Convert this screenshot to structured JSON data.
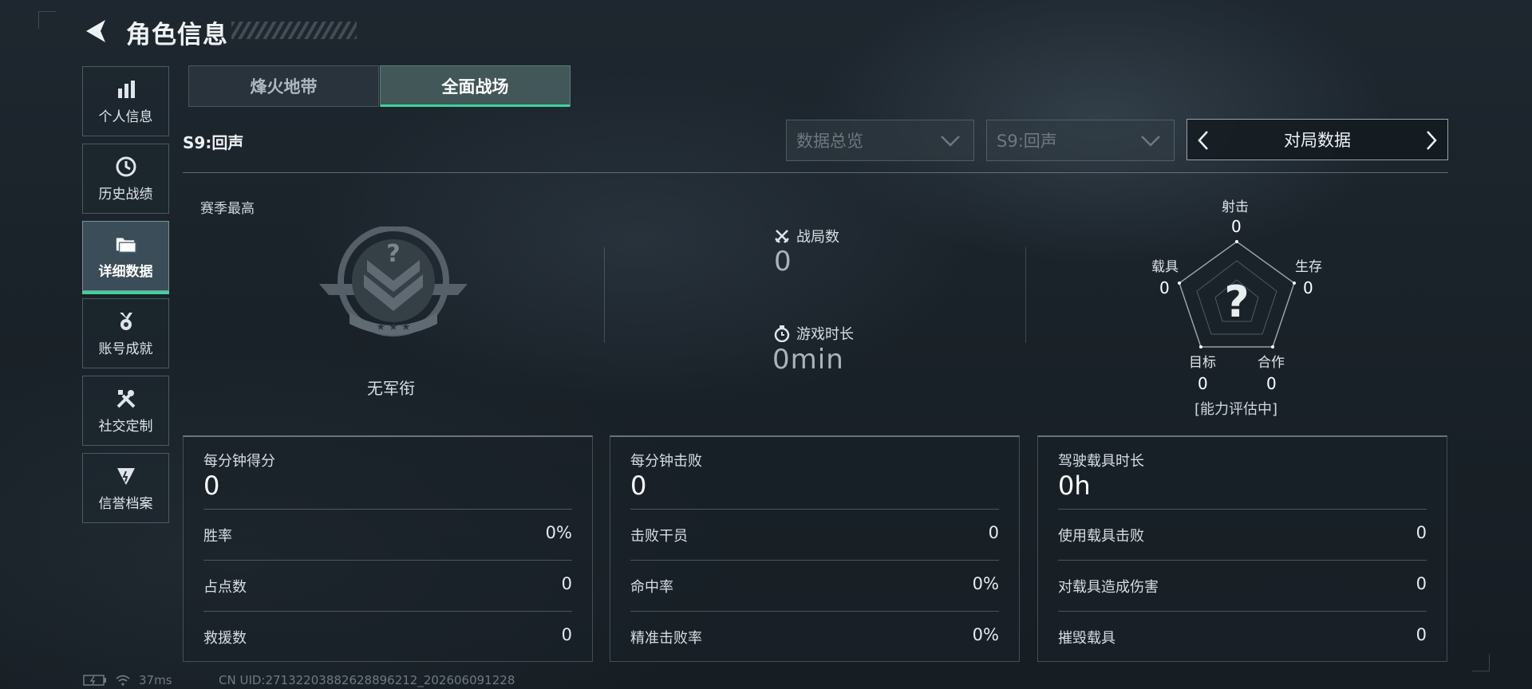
{
  "header": {
    "title": "角色信息"
  },
  "sidebar": {
    "items": [
      {
        "label": "个人信息",
        "icon": "bar-chart-icon"
      },
      {
        "label": "历史战绩",
        "icon": "history-clock-icon"
      },
      {
        "label": "详细数据",
        "icon": "folder-icon",
        "active": true
      },
      {
        "label": "账号成就",
        "icon": "medal-icon"
      },
      {
        "label": "社交定制",
        "icon": "tools-icon"
      },
      {
        "label": "信誉档案",
        "icon": "shield-badge-icon"
      }
    ]
  },
  "tabs": [
    {
      "label": "烽火地带",
      "selected": false
    },
    {
      "label": "全面战场",
      "selected": true
    }
  ],
  "season_label": "S9:回声",
  "filters": {
    "overview": "数据总览",
    "season": "S9:回声",
    "switcher": "对局数据"
  },
  "season_best": {
    "label": "赛季最高",
    "rank": "无军衔"
  },
  "stats": {
    "games_label": "战局数",
    "games_value": "0",
    "time_label": "游戏时长",
    "time_value": "0min"
  },
  "radar": {
    "axes": [
      {
        "label": "射击",
        "value": "0"
      },
      {
        "label": "生存",
        "value": "0"
      },
      {
        "label": "合作",
        "value": "0"
      },
      {
        "label": "目标",
        "value": "0"
      },
      {
        "label": "载具",
        "value": "0"
      }
    ],
    "status": "[能力评估中]"
  },
  "cards": [
    {
      "title": "每分钟得分",
      "value": "0",
      "rows": [
        {
          "label": "胜率",
          "value": "0%"
        },
        {
          "label": "占点数",
          "value": "0"
        },
        {
          "label": "救援数",
          "value": "0"
        }
      ]
    },
    {
      "title": "每分钟击败",
      "value": "0",
      "rows": [
        {
          "label": "击败干员",
          "value": "0"
        },
        {
          "label": "命中率",
          "value": "0%"
        },
        {
          "label": "精准击败率",
          "value": "0%"
        }
      ]
    },
    {
      "title": "驾驶载具时长",
      "value": "0h",
      "rows": [
        {
          "label": "使用载具击败",
          "value": "0"
        },
        {
          "label": "对载具造成伤害",
          "value": "0"
        },
        {
          "label": "摧毁载具",
          "value": "0"
        }
      ]
    }
  ],
  "status_bar": {
    "ping": "37ms",
    "uid": "CN UID:27132203882628896212_202606091228"
  },
  "colors": {
    "accent": "#3fd29a",
    "background": "#1b232a"
  }
}
